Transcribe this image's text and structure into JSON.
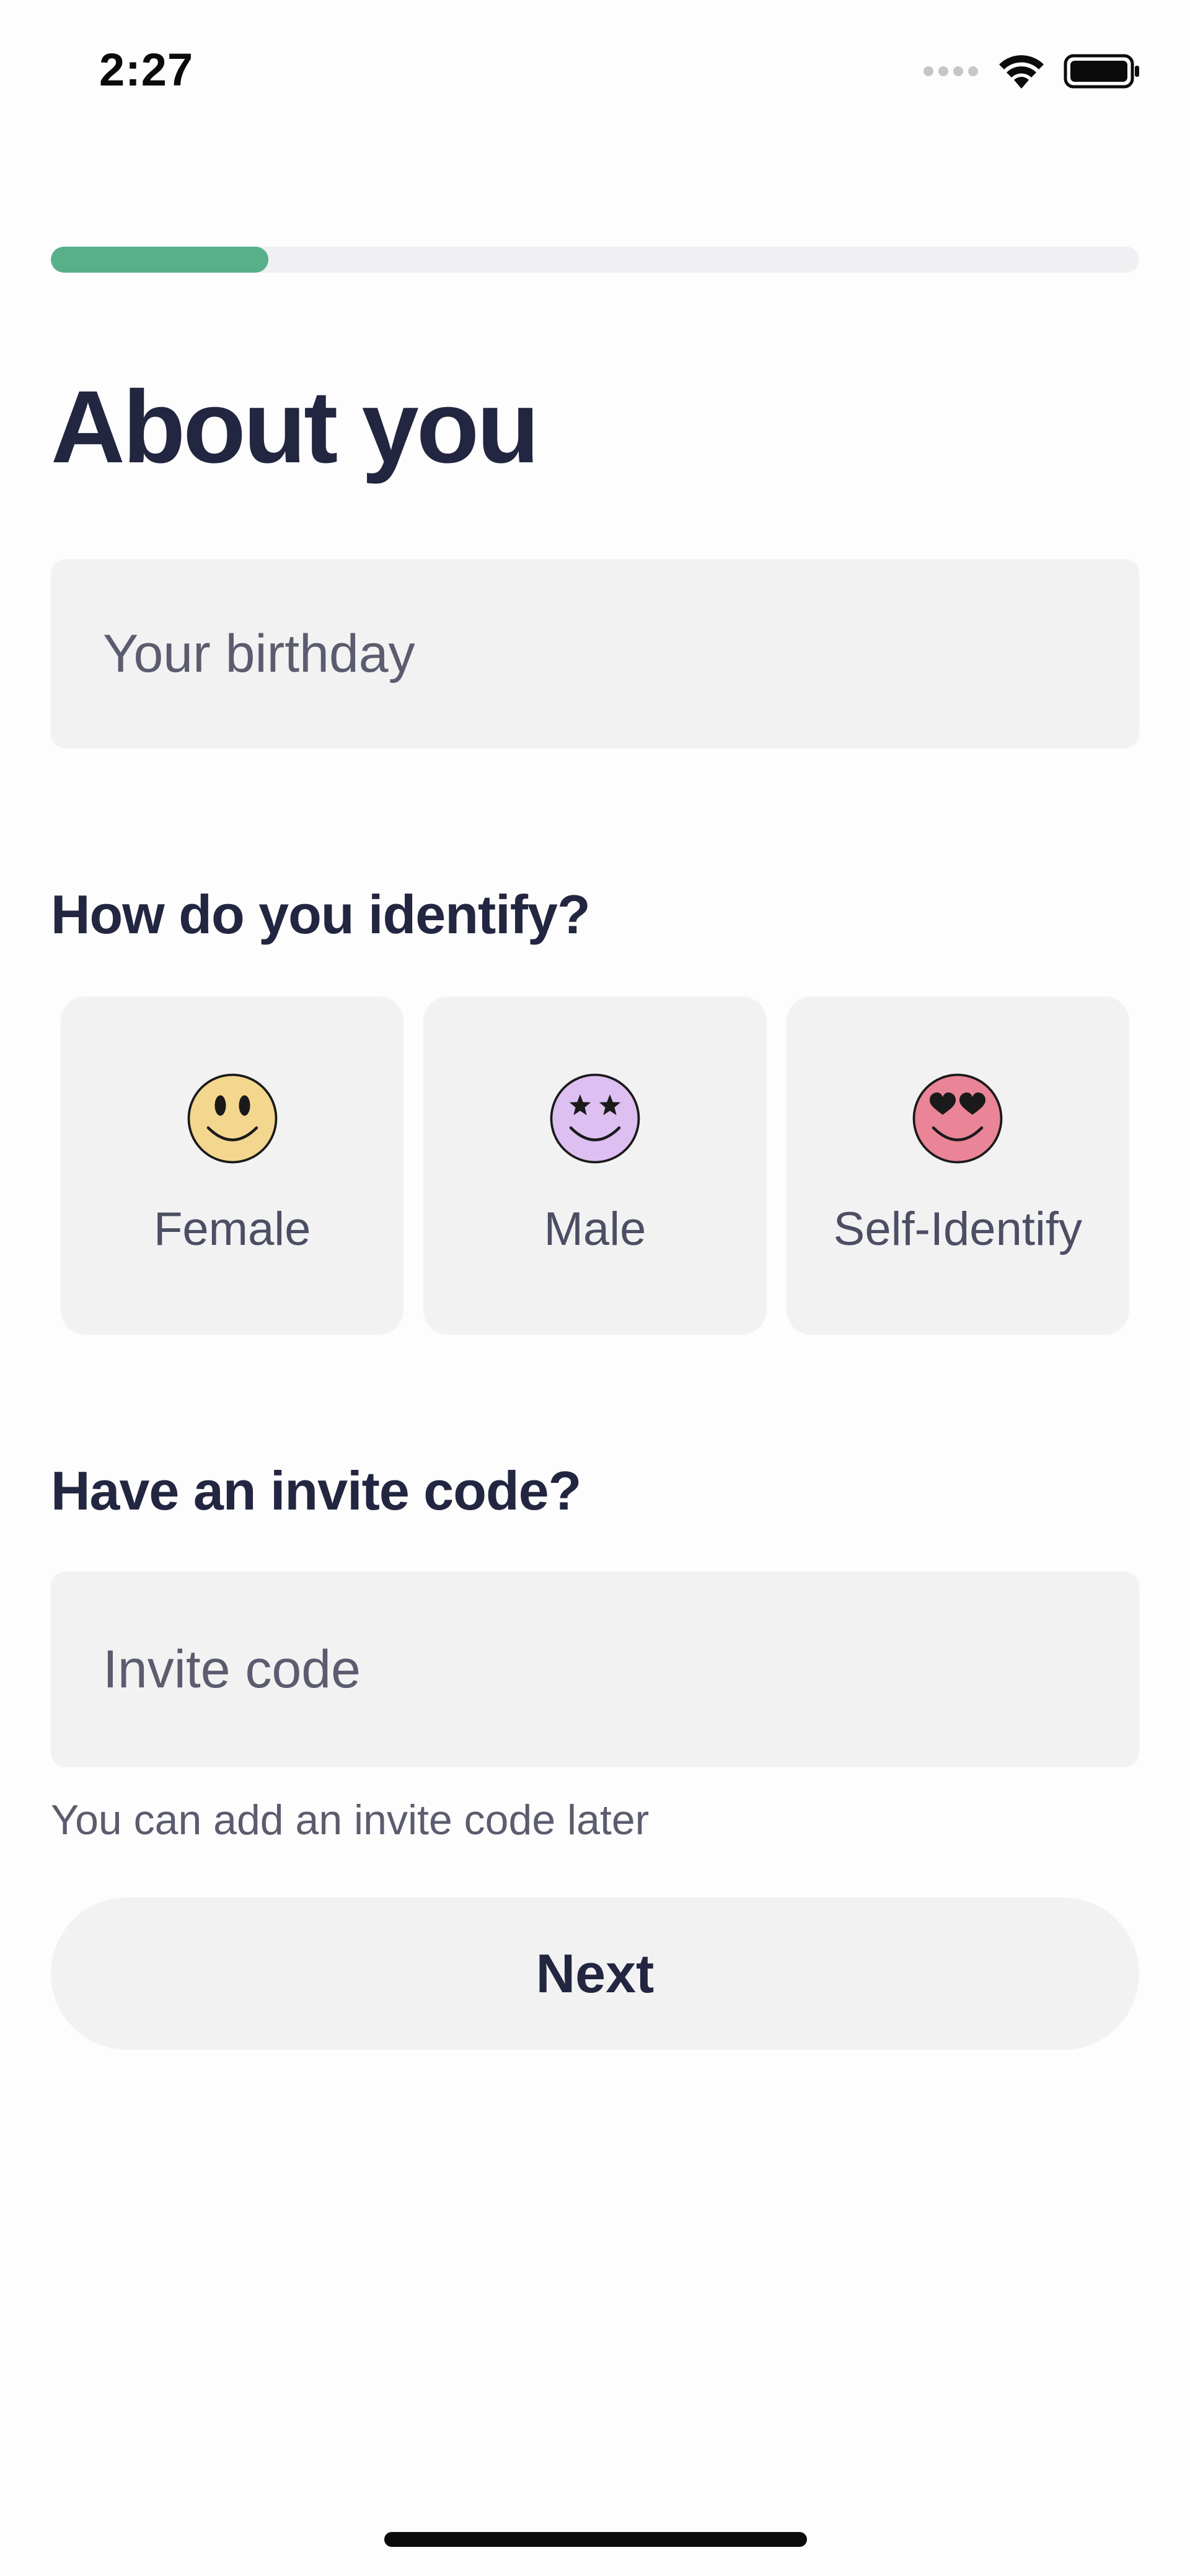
{
  "status_bar": {
    "time": "2:27",
    "signal_icon": "signal-dots-icon",
    "wifi_icon": "wifi-icon",
    "battery_icon": "battery-icon"
  },
  "progress": {
    "fraction": 0.2,
    "fill_color": "#57b08a",
    "track_color": "#f0f0f2"
  },
  "title": "About you",
  "birthday_field": {
    "placeholder": "Your birthday"
  },
  "identify_section": {
    "label": "How do you identify?",
    "options": [
      {
        "label": "Female",
        "icon": "smiley-face-icon",
        "icon_color": "#f3d78f"
      },
      {
        "label": "Male",
        "icon": "star-eyes-face-icon",
        "icon_color": "#ddbff2"
      },
      {
        "label": "Self-Identify",
        "icon": "heart-eyes-face-icon",
        "icon_color": "#ea8497"
      }
    ]
  },
  "invite_section": {
    "label": "Have an invite code?",
    "placeholder": "Invite code",
    "hint": "You can add an invite code later"
  },
  "next_button": {
    "label": "Next"
  }
}
